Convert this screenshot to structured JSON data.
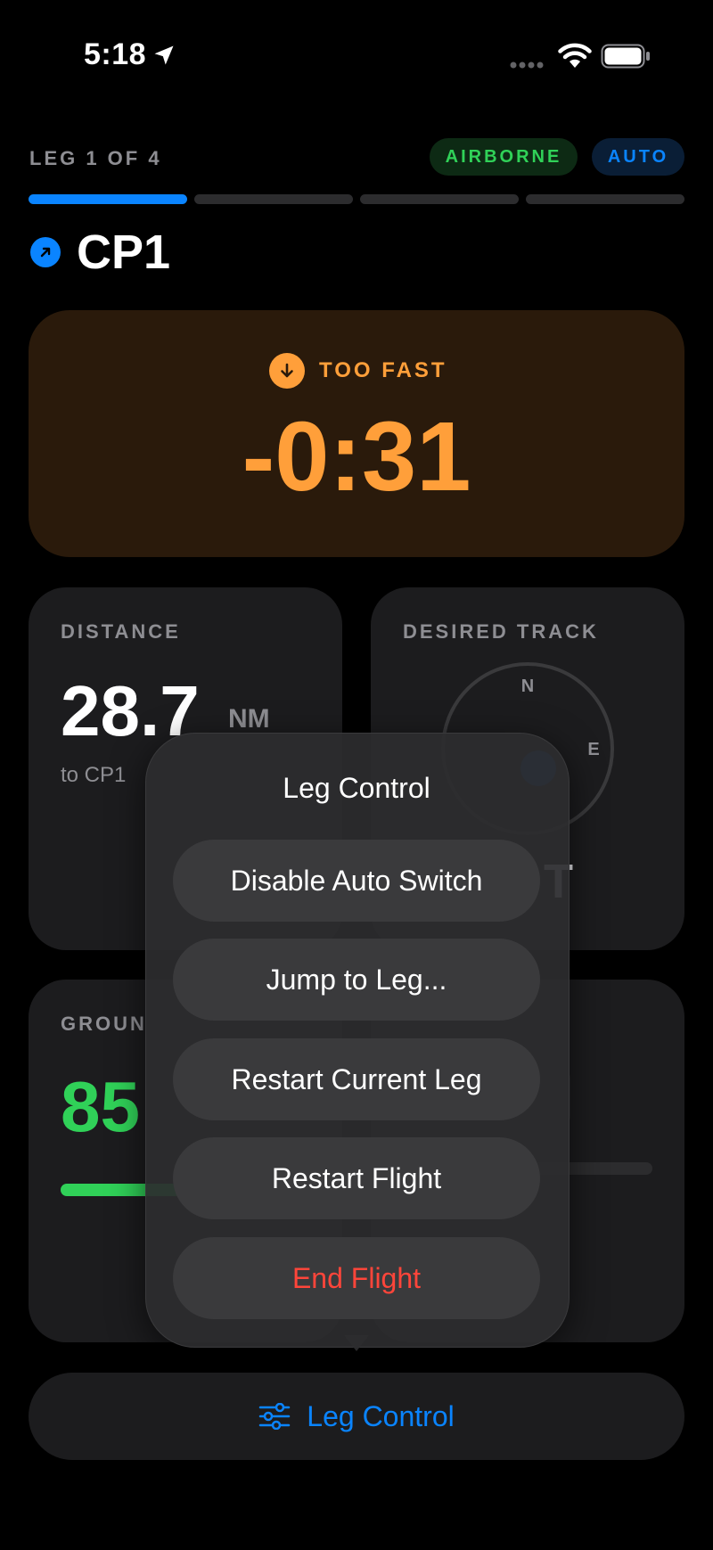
{
  "status_bar": {
    "time": "5:18",
    "icons": [
      "location-arrow-icon",
      "cellular-signal-icon",
      "wifi-icon",
      "battery-icon"
    ]
  },
  "header": {
    "leg_label": "LEG 1 OF 4",
    "badges": [
      {
        "label": "AIRBORNE",
        "color": "#30d158"
      },
      {
        "label": "AUTO",
        "color": "#0a84ff"
      }
    ],
    "progress": {
      "total_legs": 4,
      "current_leg": 1,
      "active_color": "#0a84ff"
    },
    "checkpoint": {
      "icon": "arrow-up-right-icon",
      "name": "CP1"
    }
  },
  "timing": {
    "status": "TOO FAST",
    "icon": "arrow-down-icon",
    "delta": "-0:31",
    "accent_color": "#ff9f3a"
  },
  "distance_card": {
    "label": "DISTANCE",
    "value": "28.7",
    "unit": "NM",
    "sub": "to CP1"
  },
  "track_card": {
    "label": "DESIRED TRACK",
    "compass_labels": [
      "N",
      "E"
    ],
    "value_partial": "T"
  },
  "ground_card": {
    "label": "GROUN",
    "value": "85",
    "color": "#30d158"
  },
  "menu": {
    "title": "Leg Control",
    "items": [
      {
        "label": "Disable Auto Switch",
        "destructive": false
      },
      {
        "label": "Jump to Leg...",
        "destructive": false
      },
      {
        "label": "Restart Current Leg",
        "destructive": false
      },
      {
        "label": "Restart Flight",
        "destructive": false
      },
      {
        "label": "End Flight",
        "destructive": true
      }
    ]
  },
  "bottom_button": {
    "label": "Leg Control",
    "icon": "sliders-icon",
    "color": "#0a84ff"
  }
}
